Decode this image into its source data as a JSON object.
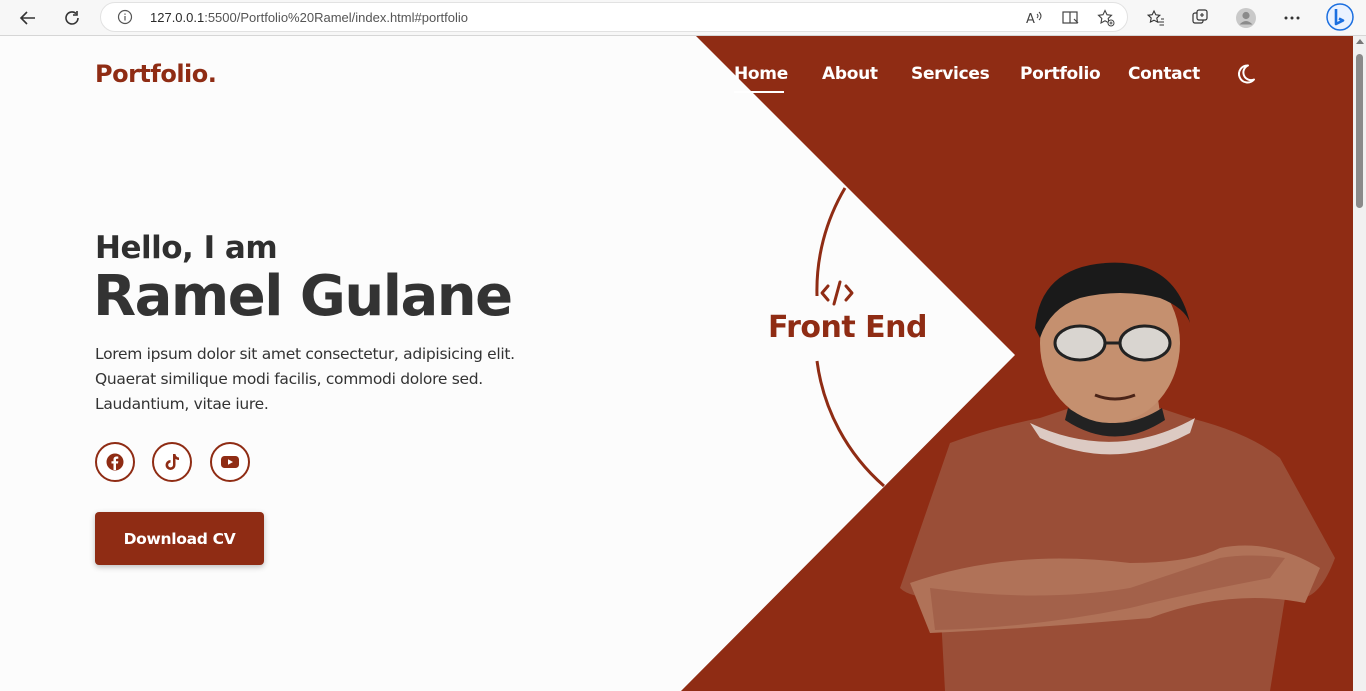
{
  "browser": {
    "url_host": "127.0.0.1",
    "url_rest": ":5500/Portfolio%20Ramel/index.html#portfolio"
  },
  "header": {
    "logo": "Portfolio.",
    "nav": [
      "Home",
      "About",
      "Services",
      "Portfolio",
      "Contact"
    ],
    "active_nav": "Home"
  },
  "hero": {
    "greeting": "Hello, I am",
    "name": "Ramel Gulane",
    "description": "Lorem ipsum dolor sit amet consectetur, adipisicing elit. Quaerat similique modi facilis, commodi dolore sed. Laudantium, vitae iure.",
    "social_icons": [
      "facebook-icon",
      "tiktok-icon",
      "youtube-icon"
    ],
    "cta": "Download CV",
    "role": "Front End",
    "role_icon": "code-icon"
  },
  "colors": {
    "accent": "#8f2c14",
    "background": "#fcfcfc",
    "text": "#333333"
  }
}
